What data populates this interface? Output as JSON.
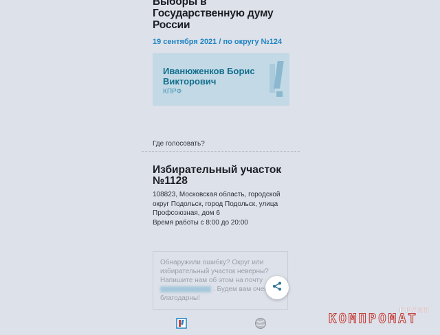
{
  "election": {
    "title": "Выборы в Государственную думу России",
    "date_district": "19 сентября 2021 / по округу №124"
  },
  "candidate": {
    "name": "Иванюженков Борис Викторович",
    "party": "КПРФ"
  },
  "where_to_vote": {
    "label": "Где голосовать?"
  },
  "polling_station": {
    "title": "Избирательный участок №1128",
    "address": "108823, Московская область, городской округ Подольск, город Подольск, улица Профсоюзная, дом 6",
    "hours": "Время работы с 8:00 до 20:00"
  },
  "error_notice": {
    "text_before": "Обнаружили ошибку? Округ или избирательный участок неверны? Напишите нам об этом на почту",
    "text_after": ". Будем вам очень благодарны!"
  },
  "watermark": {
    "small": "ГРУПП",
    "big": "КОМПРОМАТ"
  },
  "colors": {
    "background": "#dde1e9",
    "accent_blue": "#1e84c3",
    "card_bg": "#c3dae6",
    "card_name": "#126f8d",
    "watermark_red": "#c03636"
  },
  "icons": {
    "share": "share-icon",
    "nav_home": "ballot-logo-icon",
    "nav_globe": "globe-icon"
  }
}
